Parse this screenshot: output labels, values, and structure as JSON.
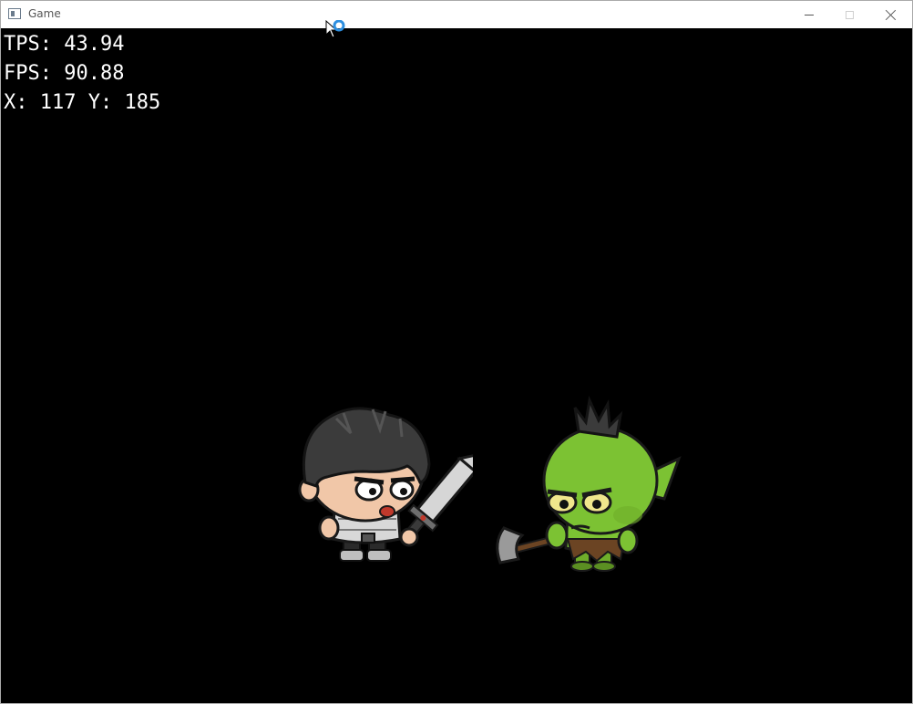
{
  "window": {
    "title": "Game",
    "icon": "app-window-icon",
    "controls": {
      "minimize": "minimize-icon",
      "maximize": "maximize-icon",
      "close": "close-icon"
    }
  },
  "hud": {
    "tps": "TPS: 43.94",
    "fps": "FPS: 90.88",
    "position": "X: 117 Y: 185"
  },
  "scene": {
    "background": "#000000",
    "characters": [
      {
        "name": "knight-hero",
        "weapon": "sword"
      },
      {
        "name": "green-orc",
        "weapon": "axe"
      }
    ]
  },
  "cursor": {
    "type": "busy-arrow-cursor",
    "spinner_color": "#2d8fe0"
  }
}
